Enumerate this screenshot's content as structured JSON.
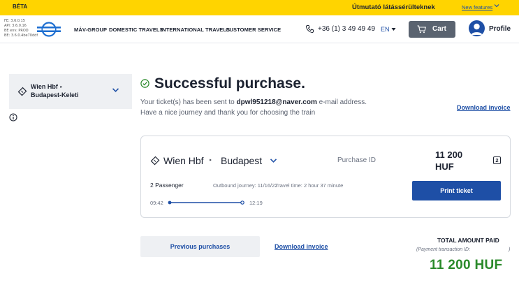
{
  "beta_bar": {
    "label": "BÉTA",
    "accessibility_link": "Útmutató látássérülteknek",
    "new_features": "New features"
  },
  "header": {
    "versions": [
      "FE: 3.6.0.15",
      "API: 3.6.0.16",
      "BE env: PROD",
      "BE: 3.6.0.4be70ddf"
    ],
    "nav": [
      "MÁV-GROUP",
      "DOMESTIC TRAVELS",
      "INTERNATIONAL TRAVELS",
      "CUSTOMER SERVICE"
    ],
    "phone": "+36 (1) 3 49 49 49",
    "language": "EN",
    "cart_label": "Cart",
    "profile_label": "Profile"
  },
  "route_panel": {
    "from": "Wien Hbf",
    "arrow": "‣",
    "to": "Budapest-Keleti"
  },
  "success": {
    "title": "Successful purchase.",
    "message_prefix": "Your ticket(s) has been sent to ",
    "email": "dpwl951218@naver.com",
    "message_suffix": " e-mail address.",
    "message_line2": "Have a nice journey and thank you for choosing the train",
    "download_invoice": "Download invoice"
  },
  "ticket": {
    "from": "Wien Hbf",
    "arrow": "‣",
    "to": "Budapest",
    "purchase_id_label": "Purchase ID",
    "price_amount": "11 200",
    "price_currency": "HUF",
    "passenger_count_badge": "2",
    "passengers": "2 Passenger",
    "outbound": "Outbound journey: 11/16/22",
    "travel_time": "Travel time:  2 hour 37 minute",
    "departure": "09:42",
    "arrival": "12:19",
    "print_button": "Print ticket"
  },
  "footer": {
    "previous_purchases": "Previous purchases",
    "download_invoice": "Download invoice",
    "total_label": "TOTAL AMOUNT PAID",
    "payment_tx_label": "(Payment transaction ID:",
    "payment_tx_end": ")",
    "total_amount": "11 200  HUF"
  },
  "colors": {
    "beta_yellow": "#ffd400",
    "brand_blue": "#1e4fa6",
    "success_green": "#2a8a2a",
    "cart_gray": "#5a6370"
  }
}
